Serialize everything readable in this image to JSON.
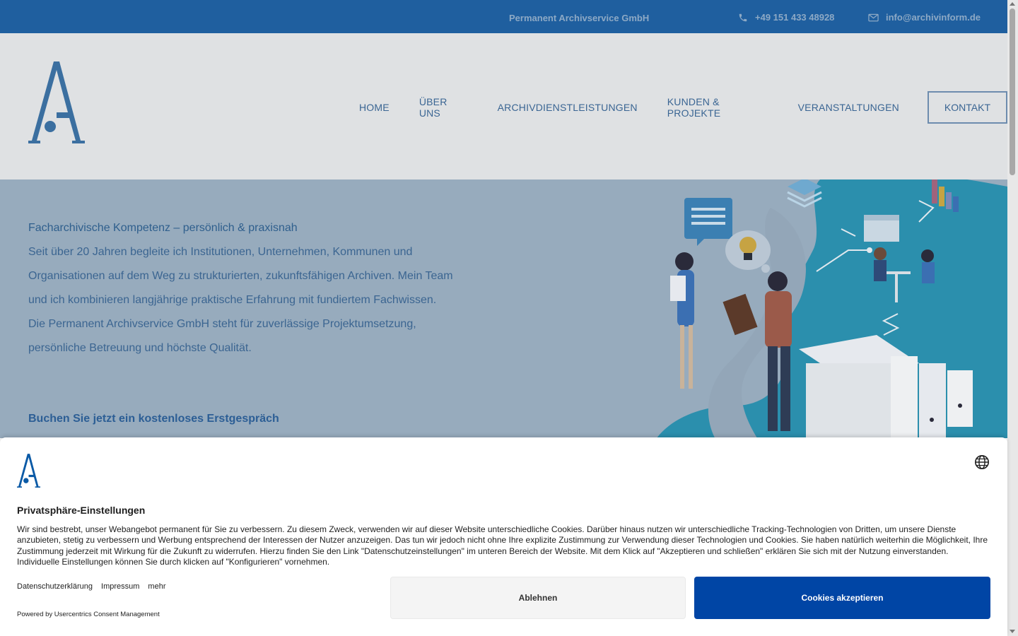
{
  "topbar": {
    "company": "Permanent Archivservice GmbH",
    "phone": "+49 151 433 48928",
    "email": "info@archivinform.de"
  },
  "nav": {
    "items": [
      "HOME",
      "ÜBER UNS",
      "ARCHIVDIENSTLEISTUNGEN",
      "KUNDEN & PROJEKTE",
      "VERANSTALTUNGEN"
    ],
    "contact": "KONTAKT"
  },
  "hero": {
    "headline": "Facharchivische Kompetenz – persönlich & praxisnah",
    "paragraph1": "Seit über 20 Jahren begleite ich Institutionen, Unternehmen, Kommunen und Organisationen auf dem Weg zu strukturierten, zukunftsfähigen Archiven. Mein Team und ich kombinieren langjährige praktische Erfahrung mit fundiertem Fachwissen.",
    "paragraph2": "Die Permanent Archivservice GmbH steht für zuverlässige Projektumsetzung, persönliche Betreuung und höchste Qualität.",
    "cta": "Buchen Sie jetzt ein kostenloses Erstgespräch"
  },
  "consent": {
    "title": "Privatsphäre-Einstellungen",
    "text": "Wir sind bestrebt, unser Webangebot permanent für Sie zu verbessern. Zu diesem Zweck, verwenden wir auf dieser Website unterschiedliche Cookies. Darüber hinaus nutzen wir unterschiedliche Tracking-Technologien von Dritten, um unsere Dienste anzubieten, stetig zu verbessern und Werbung entsprechend der Interessen der Nutzer anzuzeigen. Das tun wir jedoch nicht ohne Ihre explizite Zustimmung zur Verwendung dieser Technologien und Cookies. Sie haben natürlich weiterhin die Möglichkeit, Ihre Zustimmung jederzeit mit Wirkung für die Zukunft zu widerrufen. Hierzu finden Sie den Link \"Datenschutzeinstellungen\" im unteren Bereich der Website. Mit dem Klick auf \"Akzeptieren und schließen\" erklären Sie sich mit der Nutzung einverstanden. Individuelle Einstellungen können Sie durch klicken auf \"Konfigurieren\" vornehmen.",
    "links": [
      "Datenschutzerklärung",
      "Impressum",
      "mehr"
    ],
    "powered": "Powered by Usercentrics Consent Management",
    "decline": "Ablehnen",
    "accept": "Cookies akzeptieren"
  },
  "colors": {
    "topbar": "#1f5f9f",
    "accent": "#0045a5",
    "hero_bg": "#97abbd"
  }
}
